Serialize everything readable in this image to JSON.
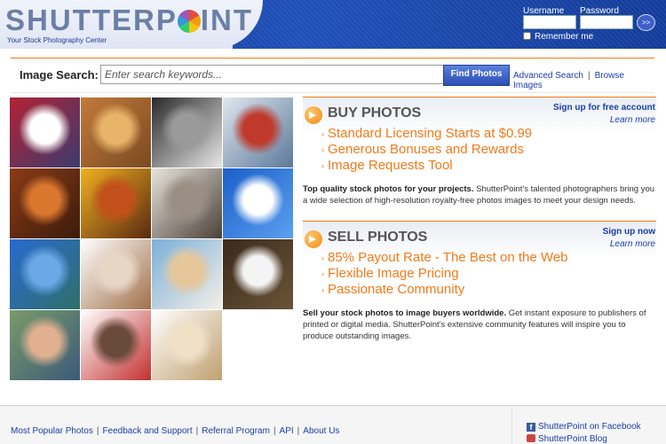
{
  "header": {
    "logo_text_before": "SHUTTERP",
    "logo_text_after": "INT",
    "tagline": "Your Stock Photography Center",
    "username_label": "Username",
    "password_label": "Password",
    "go_label": ">>",
    "remember_label": "Remember me"
  },
  "search": {
    "label": "Image Search:",
    "placeholder": "Enter search keywords...",
    "button": "Find Photos",
    "advanced": "Advanced Search",
    "separator": "|",
    "browse": "Browse Images"
  },
  "photos": [
    {
      "name": "photo-eagle-flag",
      "colors": [
        "#b22234",
        "#ffffff",
        "#3c3b6e"
      ]
    },
    {
      "name": "photo-village",
      "colors": [
        "#c27a3a",
        "#e9b36a",
        "#7a4a22"
      ]
    },
    {
      "name": "photo-bridge",
      "colors": [
        "#2a2a2a",
        "#9a9a9a",
        "#e6e6e6"
      ]
    },
    {
      "name": "photo-workers",
      "colors": [
        "#dfe6ee",
        "#c0392b",
        "#5c7a9a"
      ]
    },
    {
      "name": "photo-canyon",
      "colors": [
        "#8a3b16",
        "#d9772e",
        "#3c1b0c"
      ]
    },
    {
      "name": "photo-autumn",
      "colors": [
        "#f0b020",
        "#c2501a",
        "#5a2a10"
      ]
    },
    {
      "name": "photo-owl",
      "colors": [
        "#e8e4dc",
        "#9a8f84",
        "#4a4038"
      ]
    },
    {
      "name": "photo-snow-trees",
      "colors": [
        "#1a5fc8",
        "#ffffff",
        "#5ca0f0"
      ]
    },
    {
      "name": "photo-liberty",
      "colors": [
        "#2a6ad0",
        "#6aa8e8",
        "#2f6f6a"
      ]
    },
    {
      "name": "photo-bulldog",
      "colors": [
        "#ffffff",
        "#e8d6c4",
        "#a0704a"
      ]
    },
    {
      "name": "photo-shell",
      "colors": [
        "#7ab0d8",
        "#e6c79c",
        "#f4efe8"
      ]
    },
    {
      "name": "photo-bald-eagle",
      "colors": [
        "#3a2a1a",
        "#f4f4f4",
        "#6a5438"
      ]
    },
    {
      "name": "photo-couple",
      "colors": [
        "#7a9a6a",
        "#e0b090",
        "#3a5a7a"
      ]
    },
    {
      "name": "photo-martial-artist",
      "colors": [
        "#ffffff",
        "#6a4a3a",
        "#c23030"
      ]
    },
    {
      "name": "photo-blonde",
      "colors": [
        "#ffffff",
        "#f0e0c8",
        "#c0a070"
      ]
    }
  ],
  "buy": {
    "title": "BUY PHOTOS",
    "link1": "Sign up for free account",
    "link2": "Learn more",
    "bullets": [
      "Standard Licensing Starts at $0.99",
      "Generous Bonuses and Rewards",
      "Image Requests Tool"
    ],
    "desc_bold": "Top quality stock photos for your projects.",
    "desc_rest": " ShutterPoint's talented photographers bring you a wide selection of high-resolution royalty-free photos images to meet your design needs."
  },
  "sell": {
    "title": "SELL PHOTOS",
    "link1": "Sign up now",
    "link2": "Learn more",
    "bullets": [
      "85% Payout Rate - The Best on the Web",
      "Flexible Image Pricing",
      "Passionate Community"
    ],
    "desc_bold": "Sell your stock photos to image buyers worldwide.",
    "desc_rest": " Get instant exposure to publishers of printed or digital media. ShutterPoint's extensive community features will inspire you to produce outstanding images."
  },
  "footer": {
    "links": [
      "Most Popular Photos",
      "Feedback and Support",
      "Referral Program",
      "API",
      "About Us"
    ],
    "separator": "|",
    "facebook": "ShutterPoint on Facebook",
    "blog": "ShutterPoint Blog"
  },
  "colors": {
    "accent": "#f07a1a",
    "link": "#1a3ea8",
    "header": "#1d4fb8"
  }
}
